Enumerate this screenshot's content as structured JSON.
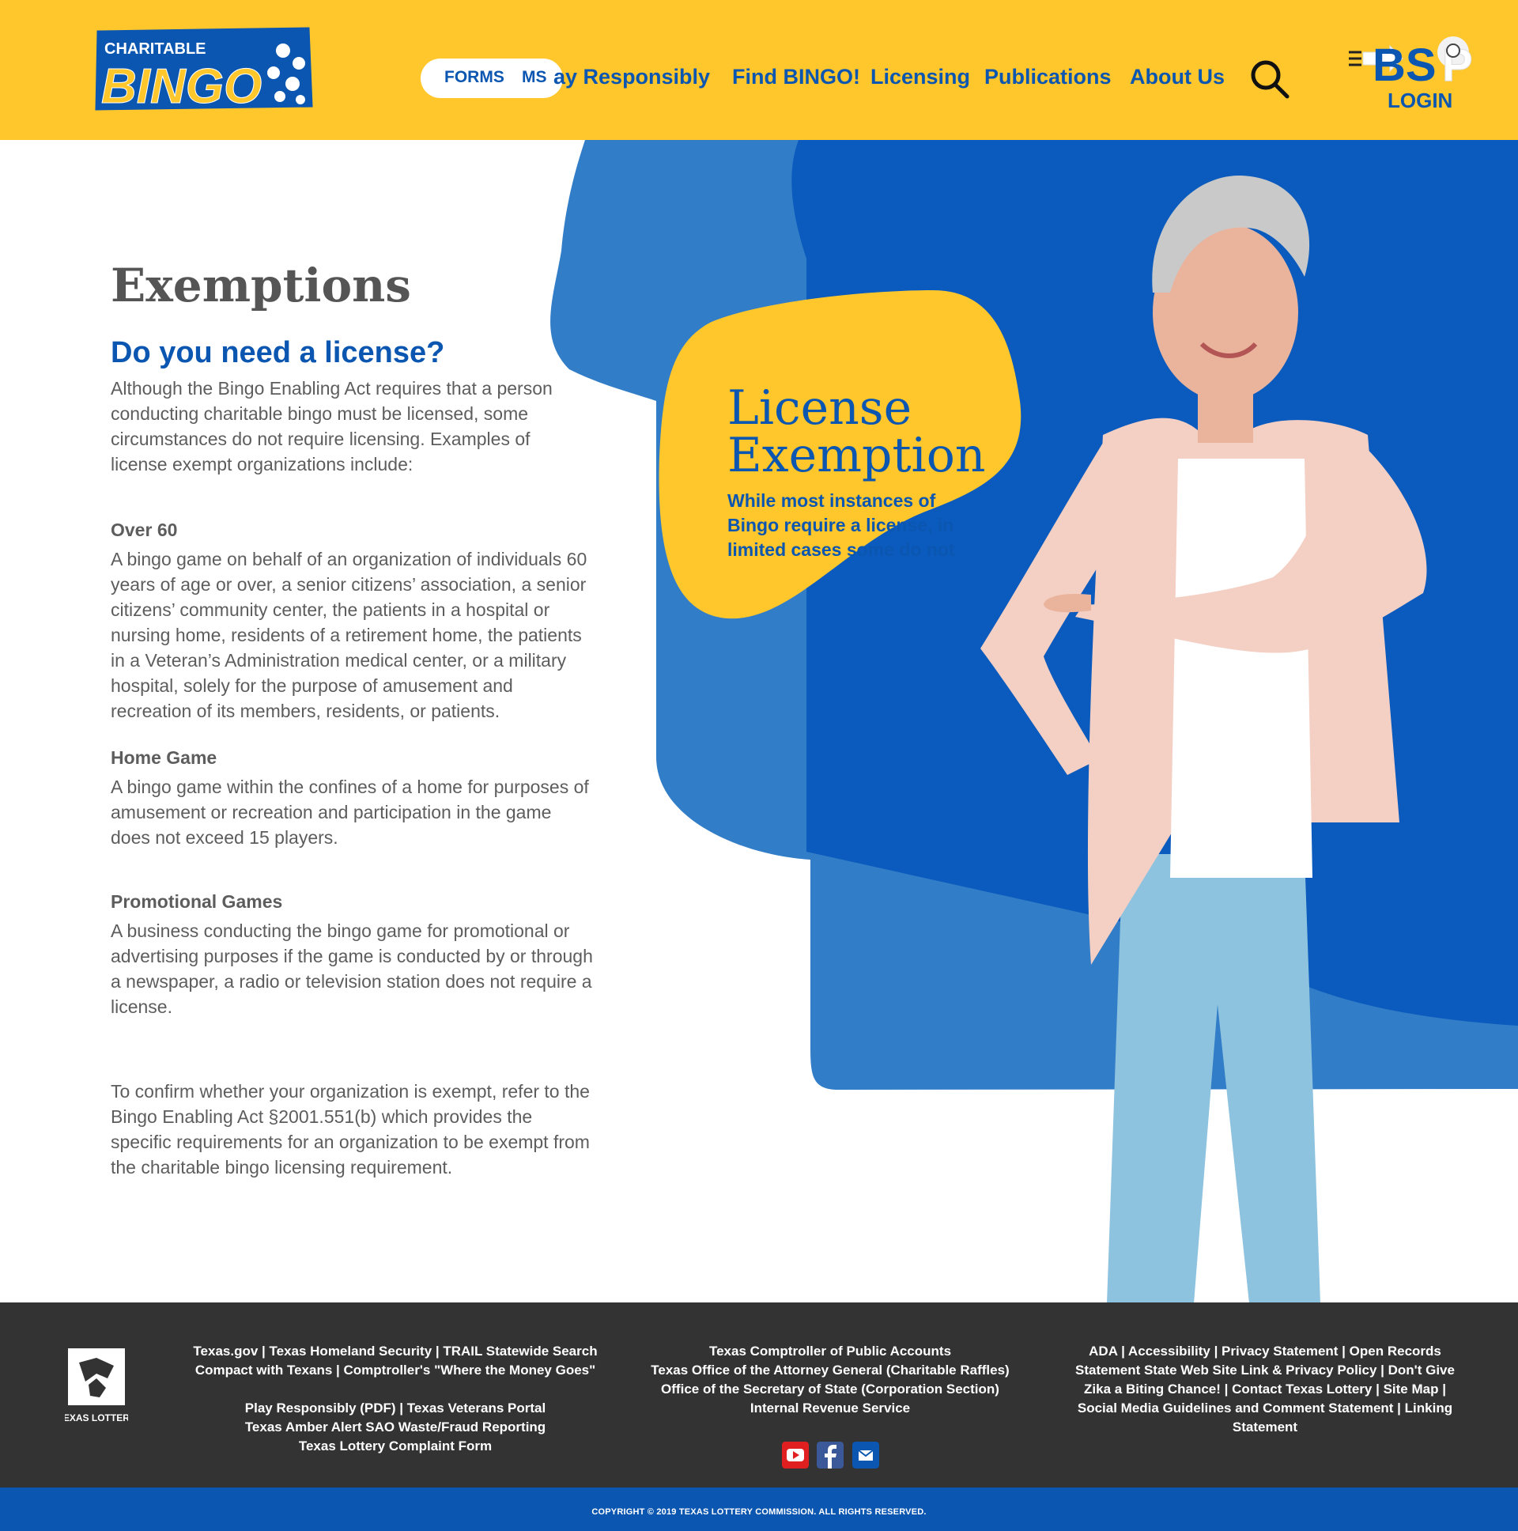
{
  "header": {
    "logo_top": "CHARITABLE",
    "logo_main": "BINGO",
    "forms_label": "FORMS",
    "forms_cut_text": "MS",
    "nav": [
      {
        "label": "ay Responsibly"
      },
      {
        "label": "Find BINGO!"
      },
      {
        "label": "Licensing"
      },
      {
        "label": "Publications"
      },
      {
        "label": "About Us"
      }
    ],
    "bsp_logo_text": "BSP",
    "login_label": "LOGIN"
  },
  "badge": {
    "title_line1": "License",
    "title_line2": "Exemption",
    "subtitle": "While most instances of Bingo require a license, in limited cases some do not"
  },
  "content": {
    "title": "Exemptions",
    "subheading": "Do you need a license?",
    "intro": "Although the Bingo Enabling Act requires that a person conducting charitable bingo must be licensed, some circumstances do not require licensing. Examples of license exempt organizations include:",
    "sections": [
      {
        "title": "Over 60",
        "text": "A bingo game on behalf of an organization of individuals 60 years of age or over, a senior citizens’ association, a senior citizens’ community center, the patients in a hospital or nursing home, residents of a retirement home, the patients in a Veteran’s Administration medical center, or a military hospital, solely for the purpose of amusement and recreation of its members, residents, or patients."
      },
      {
        "title": "Home Game",
        "text": "A bingo game within the confines of a home for purposes of amusement or recreation and participation in the game does not exceed 15 players."
      },
      {
        "title": "Promotional Games",
        "text": "A business conducting the bingo game for promotional or advertising purposes if the game is conducted by or through a newspaper, a radio or television station does not require a license."
      }
    ],
    "confirm": "To confirm whether your organization is exempt, refer to the Bingo Enabling Act §2001.551(b) which provides the specific requirements for an organization to be exempt from the charitable bingo licensing requirement."
  },
  "footer": {
    "logo_text": "TEXAS LOTTERY",
    "col1": [
      "Texas.gov | Texas Homeland Security | TRAIL Statewide Search",
      "Compact with Texans | Comptroller's \"Where the Money Goes\"",
      "",
      "Play Responsibly (PDF) | Texas Veterans Portal",
      "Texas Amber Alert SAO Waste/Fraud Reporting",
      "Texas Lottery Complaint Form"
    ],
    "col2": [
      "Texas Comptroller of Public Accounts",
      "Texas Office of the Attorney General (Charitable Raffles)",
      "Office of the Secretary of State (Corporation Section)",
      "Internal Revenue Service"
    ],
    "col3": [
      "ADA | Accessibility | Privacy Statement | Open Records",
      "Statement State Web Site Link & Privacy Policy | Don't Give",
      "Zika a Biting Chance! | Contact Texas Lottery | Site Map |",
      "Social Media Guidelines and Comment Statement | Linking",
      "Statement"
    ],
    "social": [
      {
        "icon": "youtube-icon",
        "color": "#e02020"
      },
      {
        "icon": "facebook-icon",
        "color": "#3b5998"
      },
      {
        "icon": "email-icon",
        "color": "#0b56b0"
      }
    ],
    "copyright": "COPYRIGHT © 2019 TEXAS LOTTERY COMMISSION. ALL RIGHTS RESERVED."
  },
  "colors": {
    "brand_yellow": "#ffc72c",
    "brand_blue": "#0b56b0",
    "hero_blue_light": "#327dc8",
    "footer_dark": "#333333"
  }
}
